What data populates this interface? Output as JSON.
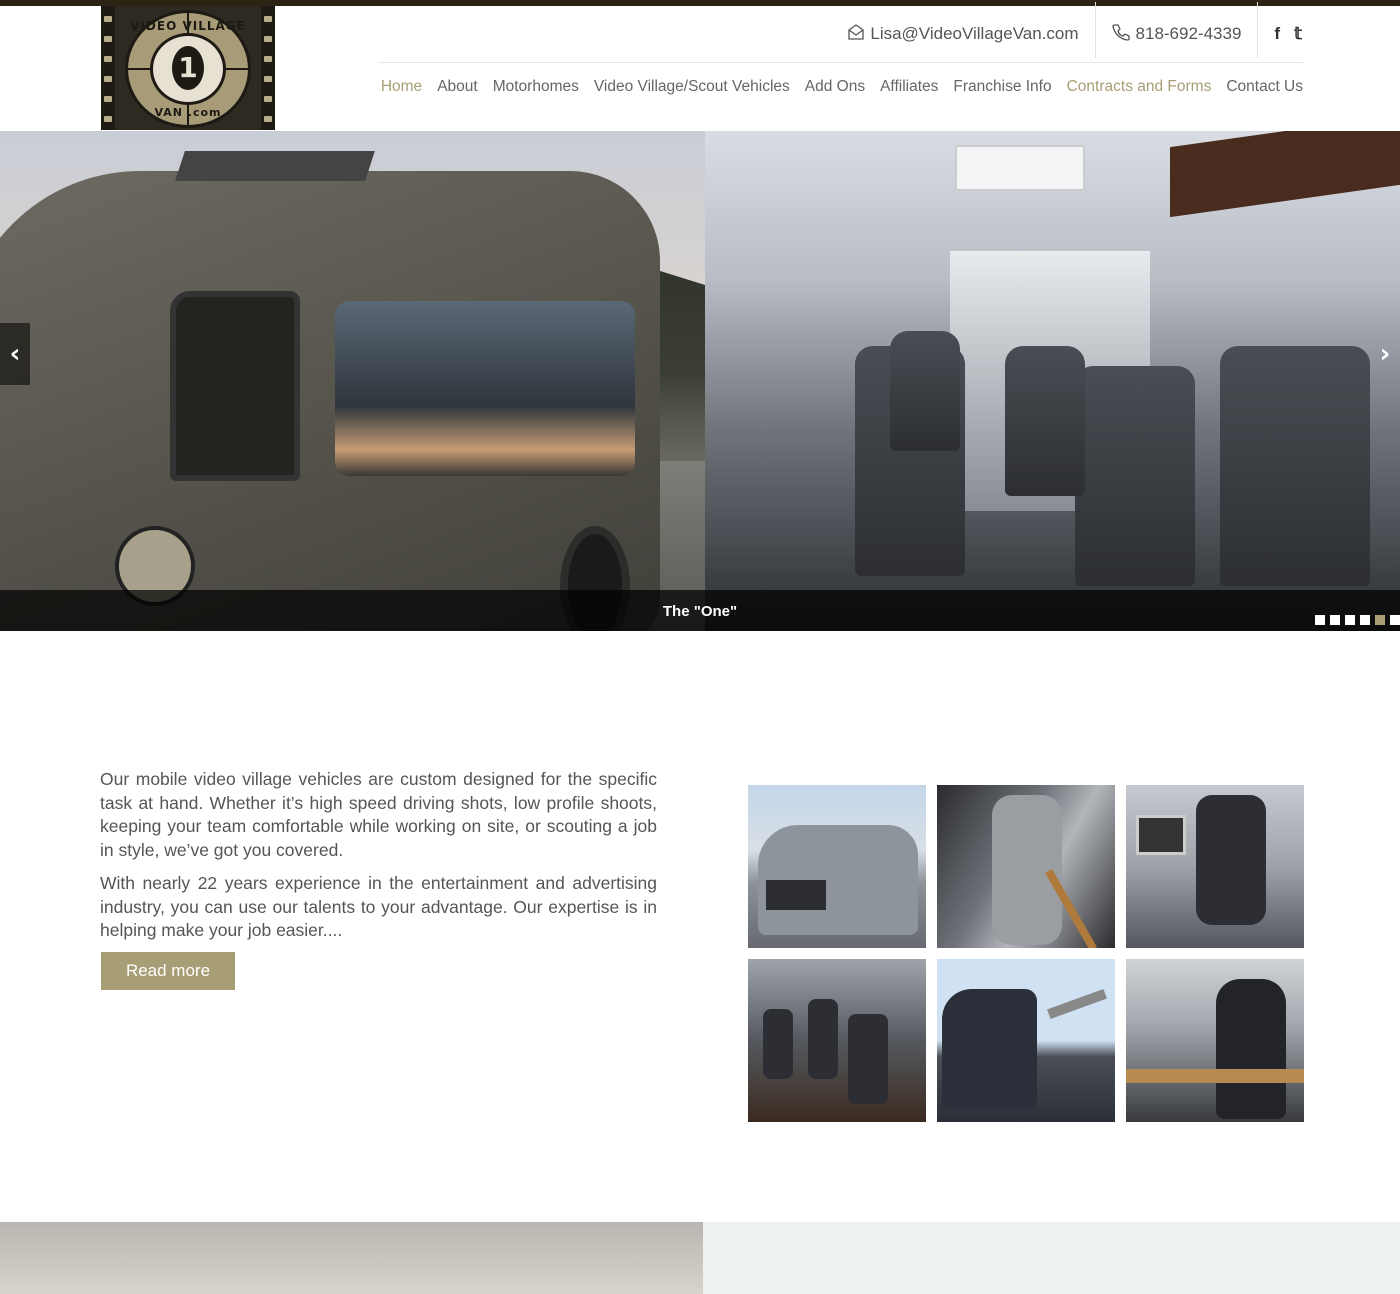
{
  "header": {
    "email": "Lisa@VideoVillageVan.com",
    "phone": "818-692-4339",
    "social": [
      "f",
      "𝕥"
    ]
  },
  "logo": {
    "top_text": "VIDEO VILLAGE",
    "number": "1",
    "bottom_text": "VAN .com"
  },
  "nav": [
    {
      "label": "Home",
      "active": true
    },
    {
      "label": "About"
    },
    {
      "label": "Motorhomes"
    },
    {
      "label": "Video Village/Scout Vehicles"
    },
    {
      "label": "Add Ons"
    },
    {
      "label": "Affiliates"
    },
    {
      "label": "Franchise Info"
    },
    {
      "label": "Contracts and Forms",
      "active": true
    },
    {
      "label": "Contact Us"
    }
  ],
  "slider": {
    "caption": "The \"One\"",
    "prev": "‹",
    "next": "›",
    "dots_total": 6,
    "dots_active": 5
  },
  "intro": {
    "p1": "Our mobile video village vehicles are custom designed for the specific task at hand. Whether it’s high speed driving shots, low profile shoots, keeping your team comfortable while working on site, or scouting a job in style, we’ve got you covered.",
    "p2": "With nearly 22 years experience in the entertainment and advertising industry, you can use our talents to your advantage. Our expertise is in helping make your job easier....",
    "read_more": "Read more"
  },
  "colors": {
    "accent": "#a89e75",
    "topbar": "#2b2313"
  }
}
